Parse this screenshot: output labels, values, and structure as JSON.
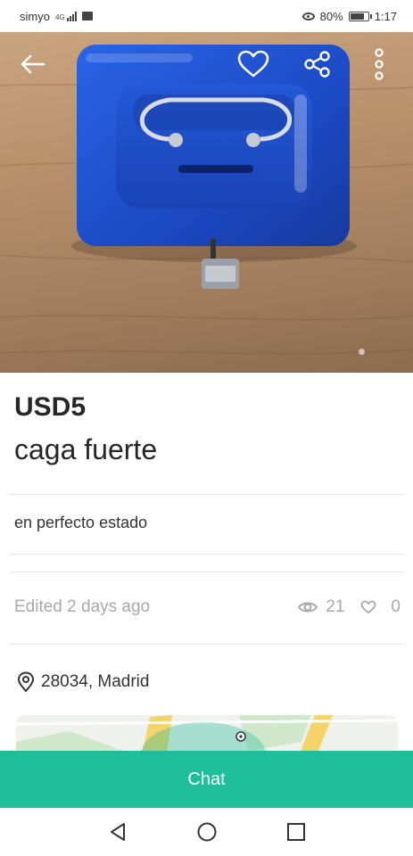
{
  "status_bar": {
    "carrier": "simyo",
    "network": "4G",
    "battery": "80%",
    "battery_level": 0.8,
    "time": "1:17"
  },
  "hero": {
    "icons": [
      "back-arrow-icon",
      "heart-icon",
      "share-icon",
      "more-vertical-icon"
    ]
  },
  "listing": {
    "price": "USD5",
    "title": "caga fuerte",
    "description": "en perfecto estado",
    "edited": "Edited 2 days ago",
    "views": "21",
    "favorites": "0",
    "location": "28034, Madrid"
  },
  "actions": {
    "chat_label": "Chat"
  },
  "colors": {
    "accent": "#1fbd9a",
    "safe_blue": "#1e4fd0"
  }
}
